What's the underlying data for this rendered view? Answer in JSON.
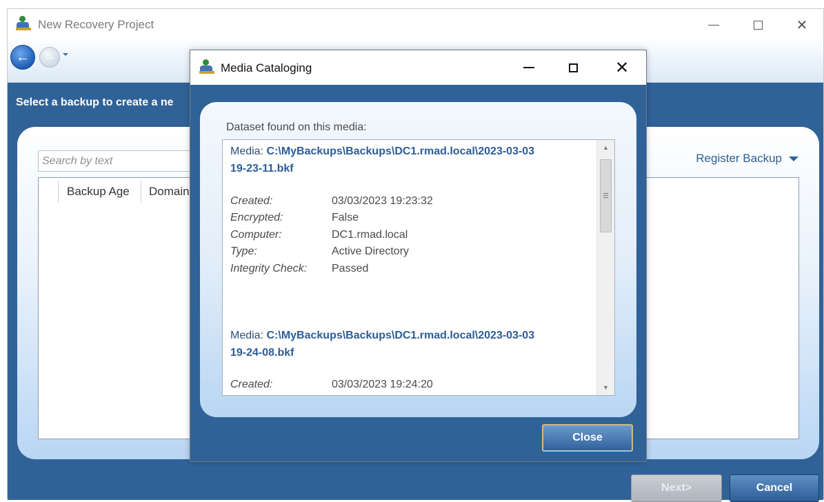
{
  "main_window": {
    "title": "New Recovery Project",
    "instruction": "Select a backup to create a ne",
    "search_placeholder": "Search by text",
    "register_label": "Register Backup",
    "columns": [
      "Backup Age",
      "Domain"
    ],
    "next_label": "Next>",
    "cancel_label": "Cancel"
  },
  "dialog": {
    "title": "Media Cataloging",
    "caption": "Dataset found on this media:",
    "media_prefix": "Media:",
    "entries": [
      {
        "path_line1": "C:\\MyBackups\\Backups\\DC1.rmad.local\\2023-03-03",
        "path_line2": "19-23-11.bkf",
        "created_label": "Created:",
        "created": "03/03/2023 19:23:32",
        "encrypted_label": "Encrypted:",
        "encrypted": "False",
        "computer_label": "Computer:",
        "computer": "DC1.rmad.local",
        "type_label": "Type:",
        "type": "Active Directory",
        "integrity_label": "Integrity Check:",
        "integrity": "Passed"
      },
      {
        "path_line1": "C:\\MyBackups\\Backups\\DC1.rmad.local\\2023-03-03",
        "path_line2": "19-24-08.bkf",
        "created_label": "Created:",
        "created": "03/03/2023 19:24:20"
      }
    ],
    "close_label": "Close"
  },
  "colors": {
    "window_blue": "#306297",
    "link_blue": "#2d5c9a",
    "focus_border": "#e9b24a"
  },
  "icons": [
    "app-logo-icon",
    "back-arrow-icon",
    "forward-arrow-icon",
    "dropdown-arrow-icon",
    "minimize-icon",
    "maximize-icon",
    "close-icon"
  ]
}
